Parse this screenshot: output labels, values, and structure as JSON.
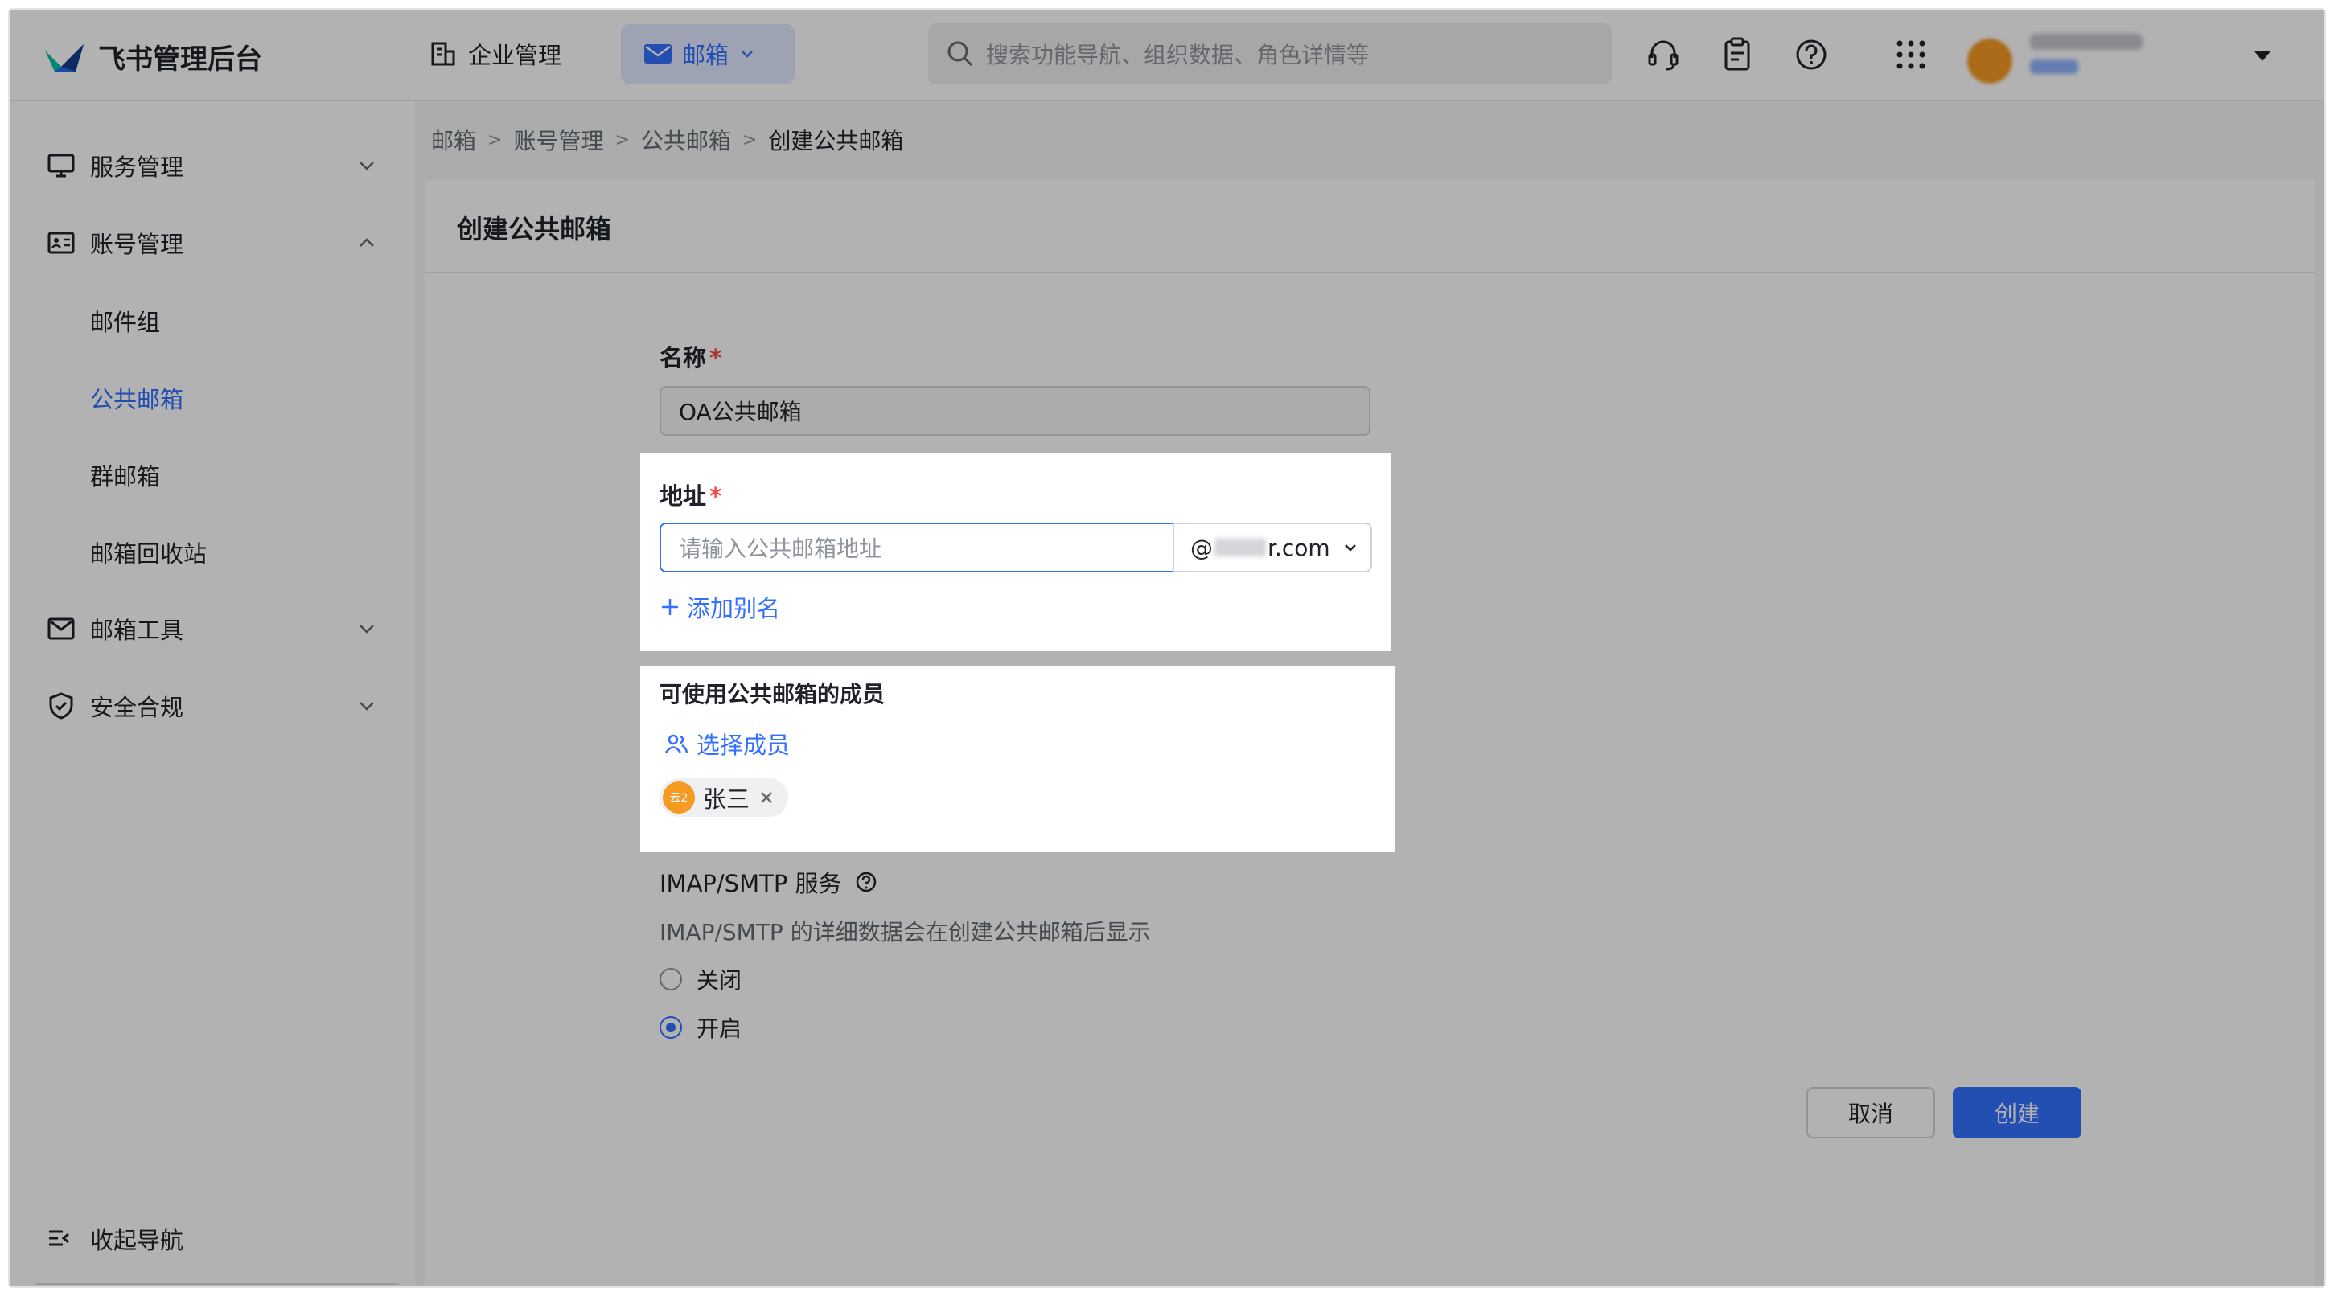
{
  "header": {
    "app_title": "飞书管理后台",
    "nav_enterprise": "企业管理",
    "nav_mail": "邮箱",
    "search_placeholder": "搜索功能导航、组织数据、角色详情等"
  },
  "sidebar": {
    "items": [
      {
        "label": "服务管理",
        "icon": "monitor-icon"
      },
      {
        "label": "账号管理",
        "icon": "id-card-icon"
      },
      {
        "label": "邮箱工具",
        "icon": "mail-icon"
      },
      {
        "label": "安全合规",
        "icon": "shield-check-icon"
      }
    ],
    "sub_items": [
      "邮件组",
      "公共邮箱",
      "群邮箱",
      "邮箱回收站"
    ],
    "active_sub": "公共邮箱",
    "collapse_label": "收起导航"
  },
  "breadcrumb": [
    "邮箱",
    "账号管理",
    "公共邮箱",
    "创建公共邮箱"
  ],
  "form": {
    "title": "创建公共邮箱",
    "name_label": "名称",
    "name_value": "OA公共邮箱",
    "address_label": "地址",
    "address_placeholder": "请输入公共邮箱地址",
    "domain_prefix": "@",
    "domain_suffix": "r.com",
    "add_alias": "添加别名",
    "members_label": "可使用公共邮箱的成员",
    "select_members": "选择成员",
    "member_tag": "张三",
    "member_avatar_text": "云2",
    "imap_label": "IMAP/SMTP 服务",
    "imap_hint": "IMAP/SMTP 的详细数据会在创建公共邮箱后显示",
    "radio_off": "关闭",
    "radio_on": "开启",
    "selected": "开启",
    "cancel": "取消",
    "create": "创建"
  },
  "colors": {
    "accent": "#3370ff",
    "required": "#f54a45",
    "avatar": "#f59a23"
  }
}
